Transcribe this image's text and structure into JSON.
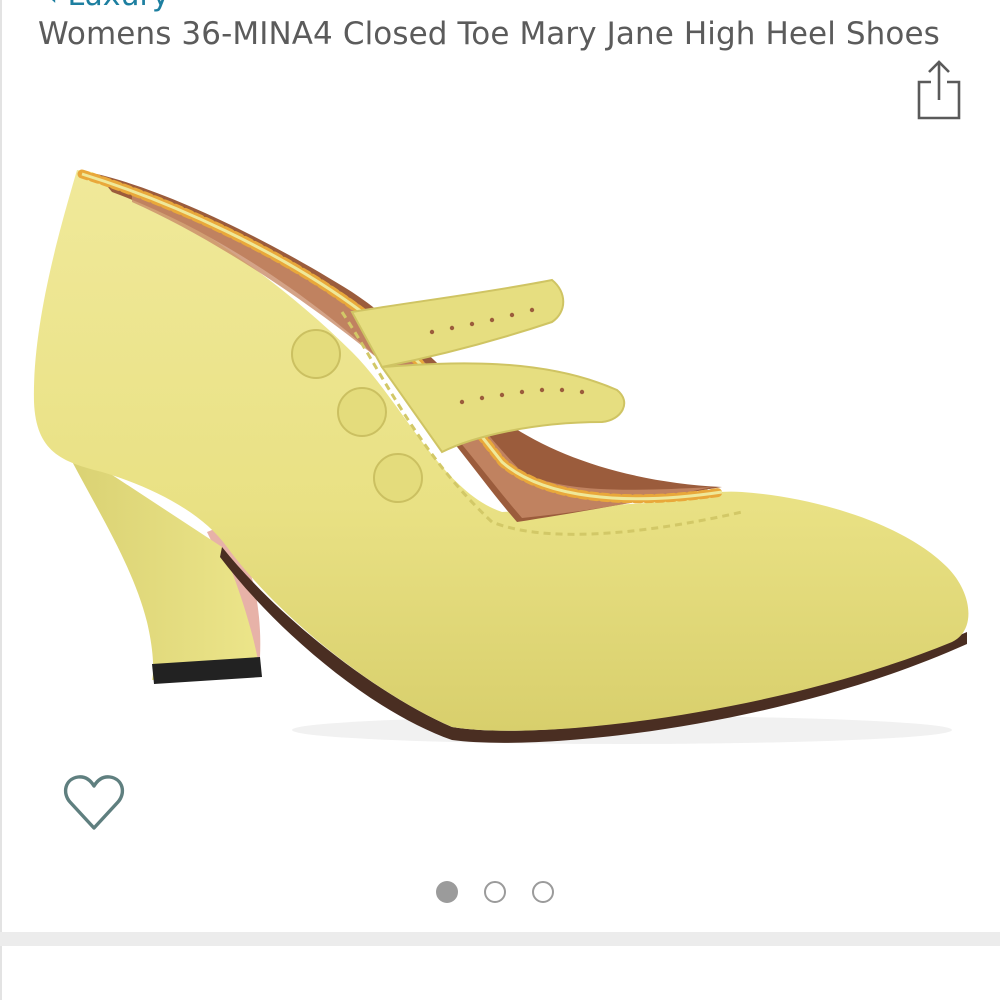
{
  "header": {
    "store_link_label": "‹ Luxury",
    "right_fragment": "⋯"
  },
  "product": {
    "title": "Womens 36-MINA4 Closed Toe Mary Jane High Heel Shoes",
    "image_subject": "yellow mary jane high heel shoe with three side buttons and scalloped trim"
  },
  "actions": {
    "share_icon": "share-icon",
    "wishlist_icon": "heart-outline-icon"
  },
  "gallery": {
    "image_count": 3,
    "current_index": 1
  },
  "colors": {
    "title_text": "#5b5b5b",
    "link": "#1d7fa0",
    "dot": "#9b9b9b",
    "divider": "#ececec",
    "shoe": "#ece58a"
  }
}
